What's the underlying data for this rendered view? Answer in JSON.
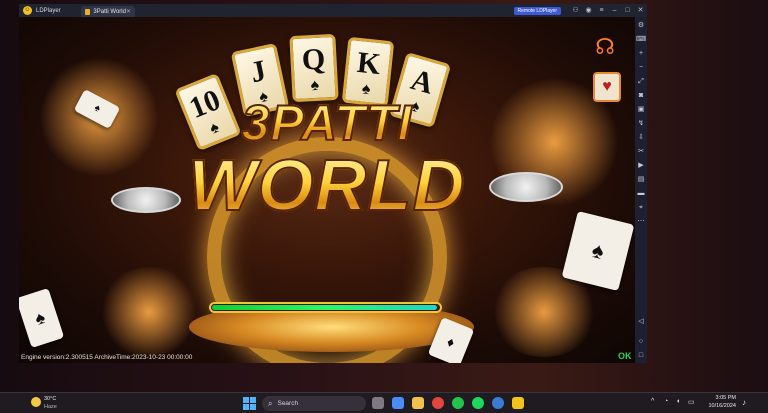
{
  "titlebar": {
    "app_name": "LDPlayer",
    "tab_label": "3Patti World",
    "tab_close": "✕",
    "remote_label": "Remote LDPlayer",
    "icons": [
      "gamepad-icon",
      "user-icon",
      "menu-icon",
      "minimize-icon",
      "maximize-icon",
      "close-icon"
    ]
  },
  "sidebar": {
    "icons": [
      "settings-icon",
      "keyboard-icon",
      "volume-up-icon",
      "volume-down-icon",
      "fullscreen-icon",
      "screenshot-icon",
      "operation-record-icon",
      "shake-icon",
      "install-apk-icon",
      "scissors-icon",
      "record-video-icon",
      "multi-instance-icon",
      "folder-icon",
      "location-icon",
      "more-icon"
    ],
    "bottom_icons": [
      "back-icon",
      "home-icon",
      "recent-apps-icon"
    ]
  },
  "game": {
    "logo_line1": "3PATTI",
    "logo_line2": "WORLD",
    "cards": [
      {
        "rank": "10",
        "suit": "♠"
      },
      {
        "rank": "J",
        "suit": "♠"
      },
      {
        "rank": "Q",
        "suit": "♠"
      },
      {
        "rank": "K",
        "suit": "♠"
      },
      {
        "rank": "A",
        "suit": "♠"
      }
    ],
    "loading_progress": 0.99,
    "engine_text": "Engine version:2.300515   ArchiveTime:2023-10-23 00:00:00",
    "ok_text": "OK",
    "accent": "#f2c33a",
    "progress_colors": [
      "#0ecf32",
      "#1fd6c8"
    ]
  },
  "taskbar": {
    "weather_temp": "30°C",
    "weather_desc": "Haze",
    "search_label": "Search",
    "clock_time": "3:05 PM",
    "clock_date": "10/16/2024"
  }
}
